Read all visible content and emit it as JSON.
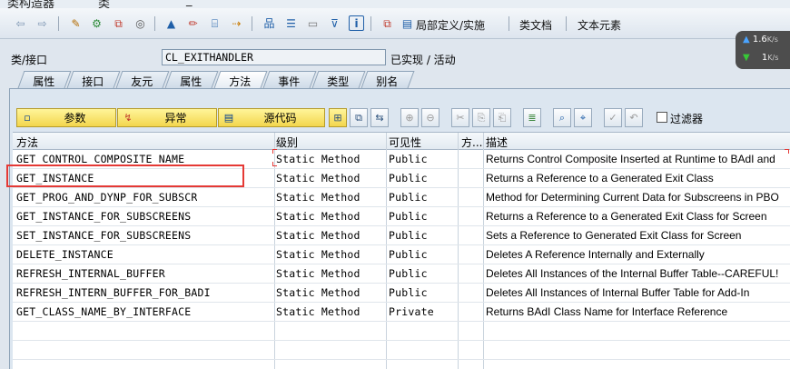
{
  "window": {
    "title_fragment_left": "类构造器",
    "title_fragment_mid": "类",
    "title_fragment_right": "_"
  },
  "toolbar": {
    "local_def_label": "局部定义/实施",
    "class_doc_label": "类文档",
    "text_elements_label": "文本元素"
  },
  "network": {
    "up": "1.6",
    "up_unit": "K/s",
    "down": "1",
    "down_unit": "K/s"
  },
  "class_row": {
    "label": "类/接口",
    "value": "CL_EXITHANDLER",
    "status": "已实现 / 活动"
  },
  "tabs": [
    "属性",
    "接口",
    "友元",
    "属性",
    "方法",
    "事件",
    "类型",
    "别名"
  ],
  "active_tab": "方法",
  "method_toolbar": {
    "params_label": "参数",
    "exceptions_label": "异常",
    "source_label": "源代码",
    "filter_label": "过滤器"
  },
  "table": {
    "headers": [
      "方法",
      "级别",
      "可见性",
      "方...",
      "描述"
    ],
    "rows": [
      {
        "method": "GET_CONTROL_COMPOSITE_NAME",
        "level": "Static Method",
        "visibility": "Public",
        "desc": "Returns Control Composite Inserted at Runtime to BAdI and"
      },
      {
        "method": "GET_INSTANCE",
        "level": "Static Method",
        "visibility": "Public",
        "desc": "Returns a Reference to a Generated Exit Class"
      },
      {
        "method": "GET_PROG_AND_DYNP_FOR_SUBSCR",
        "level": "Static Method",
        "visibility": "Public",
        "desc": "Method for Determining Current Data for Subscreens in PBO"
      },
      {
        "method": "GET_INSTANCE_FOR_SUBSCREENS",
        "level": "Static Method",
        "visibility": "Public",
        "desc": "Returns a Reference to a Generated Exit Class for Screen"
      },
      {
        "method": "SET_INSTANCE_FOR_SUBSCREENS",
        "level": "Static Method",
        "visibility": "Public",
        "desc": "Sets a Reference to Generated Exit Class for Screen"
      },
      {
        "method": "DELETE_INSTANCE",
        "level": "Static Method",
        "visibility": "Public",
        "desc": "Deletes A Reference Internally and Externally"
      },
      {
        "method": "REFRESH_INTERNAL_BUFFER",
        "level": "Static Method",
        "visibility": "Public",
        "desc": "Deletes All Instances of the Internal Buffer Table--CAREFUL!"
      },
      {
        "method": "REFRESH_INTERN_BUFFER_FOR_BADI",
        "level": "Static Method",
        "visibility": "Public",
        "desc": "Deletes All Instances of Internal Buffer Table for Add-In"
      },
      {
        "method": "GET_CLASS_NAME_BY_INTERFACE",
        "level": "Static Method",
        "visibility": "Private",
        "desc": "Returns BAdI Class Name for Interface Reference"
      }
    ]
  },
  "colors": {
    "highlight": "#e53935",
    "button_yellow": "#f3d64d",
    "panel_bg": "#dce6f0"
  }
}
